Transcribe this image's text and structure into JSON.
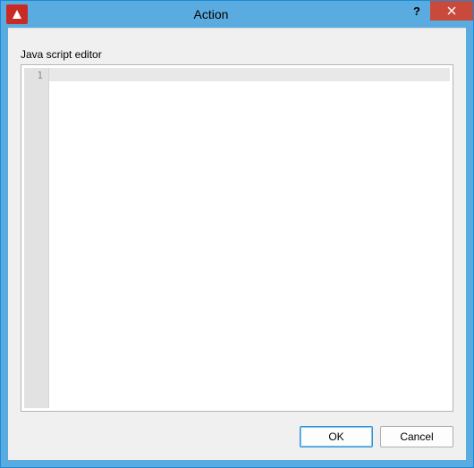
{
  "window": {
    "title": "Action",
    "help_label": "?",
    "close_label": "Close"
  },
  "editor": {
    "label": "Java script editor",
    "gutter_first_line": "1",
    "content": ""
  },
  "footer": {
    "ok_label": "OK",
    "cancel_label": "Cancel"
  }
}
